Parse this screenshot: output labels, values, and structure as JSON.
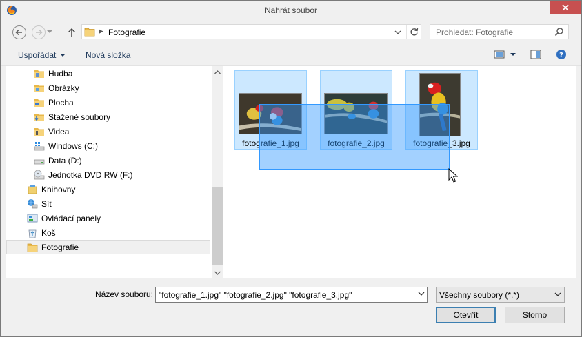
{
  "window": {
    "title": "Nahrát soubor"
  },
  "address": {
    "path": "Fotografie"
  },
  "search": {
    "placeholder": "Prohledat: Fotografie"
  },
  "toolbar": {
    "organize_label": "Uspořádat",
    "new_folder_label": "Nová složka"
  },
  "tree": {
    "items": [
      {
        "label": "Hudba",
        "icon": "music-folder-icon"
      },
      {
        "label": "Obrázky",
        "icon": "pictures-folder-icon"
      },
      {
        "label": "Plocha",
        "icon": "desktop-folder-icon"
      },
      {
        "label": "Stažené soubory",
        "icon": "downloads-folder-icon"
      },
      {
        "label": "Videa",
        "icon": "videos-folder-icon"
      },
      {
        "label": "Windows (C:)",
        "icon": "windows-drive-icon"
      },
      {
        "label": "Data (D:)",
        "icon": "hard-drive-icon"
      },
      {
        "label": "Jednotka DVD RW (F:)",
        "icon": "dvd-drive-icon"
      },
      {
        "label": "Knihovny",
        "icon": "libraries-icon"
      },
      {
        "label": "Síť",
        "icon": "network-icon"
      },
      {
        "label": "Ovládací panely",
        "icon": "control-panel-icon"
      },
      {
        "label": "Koš",
        "icon": "recycle-bin-icon"
      },
      {
        "label": "Fotografie",
        "icon": "folder-icon"
      }
    ]
  },
  "files": [
    {
      "name": "fotografie_1.jpg"
    },
    {
      "name": "fotografie_2.jpg"
    },
    {
      "name": "fotografie_3.jpg"
    }
  ],
  "bottom": {
    "filename_label": "Název souboru:",
    "filename_value": "\"fotografie_1.jpg\" \"fotografie_2.jpg\" \"fotografie_3.jpg\"",
    "filter_value": "Všechny soubory (*.*)",
    "open_label": "Otevřít",
    "cancel_label": "Storno"
  },
  "colors": {
    "selection": "#cce8ff",
    "selection_border": "#99d1ff",
    "accent": "#3399ff",
    "close": "#c75050"
  }
}
